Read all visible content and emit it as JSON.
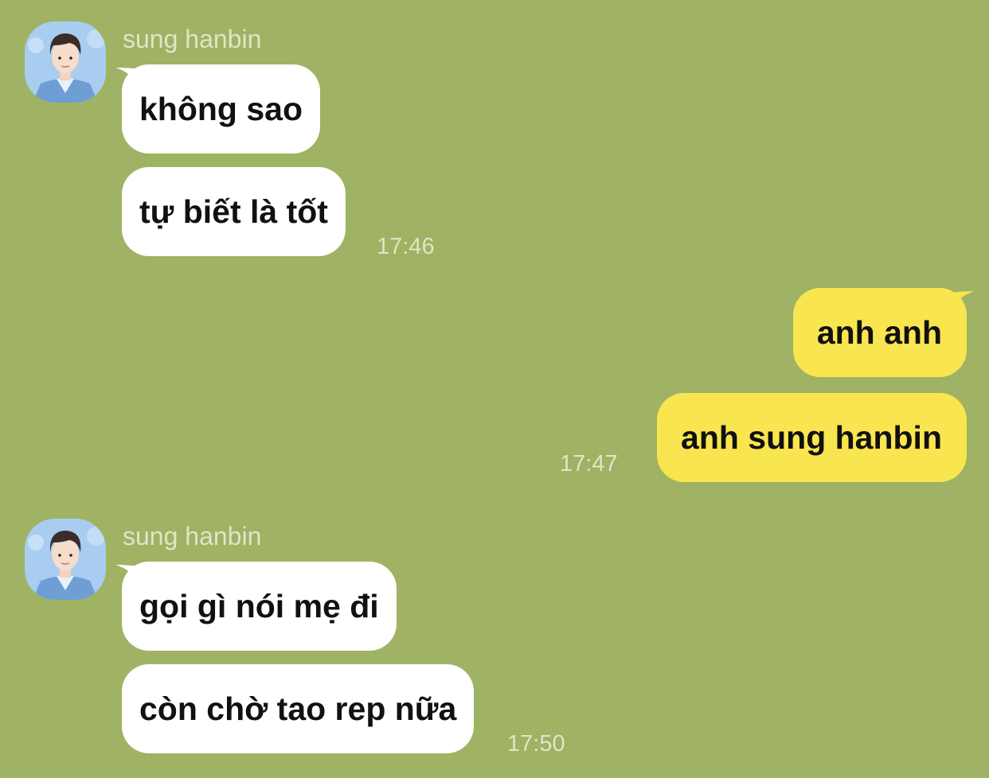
{
  "colors": {
    "background": "#a0b264",
    "incoming_bubble": "#ffffff",
    "outgoing_bubble": "#f9e54f",
    "meta_text": "#dfe6c6"
  },
  "messages": [
    {
      "direction": "incoming",
      "sender": "sung hanbin",
      "avatar_icon": "profile-photo-avatar",
      "bubbles": [
        "không sao",
        "tự biết là tốt"
      ],
      "time": "17:46"
    },
    {
      "direction": "outgoing",
      "bubbles": [
        "anh anh",
        "anh sung hanbin"
      ],
      "time": "17:47"
    },
    {
      "direction": "incoming",
      "sender": "sung hanbin",
      "avatar_icon": "profile-photo-avatar",
      "bubbles": [
        "gọi gì nói mẹ đi",
        "còn chờ tao rep nữa"
      ],
      "time": "17:50"
    }
  ]
}
